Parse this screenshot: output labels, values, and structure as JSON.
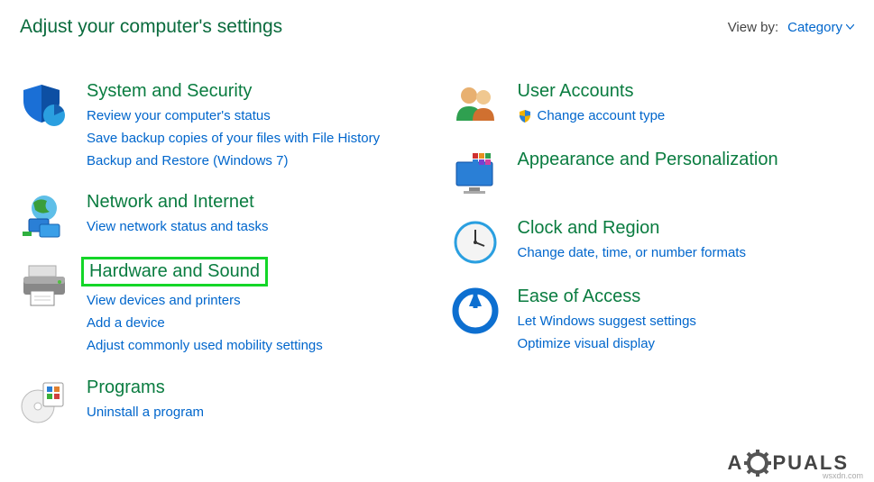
{
  "header": {
    "title": "Adjust your computer's settings",
    "view_by_label": "View by:",
    "view_by_value": "Category"
  },
  "left": [
    {
      "title": "System and Security",
      "links": [
        "Review your computer's status",
        "Save backup copies of your files with File History",
        "Backup and Restore (Windows 7)"
      ]
    },
    {
      "title": "Network and Internet",
      "links": [
        "View network status and tasks"
      ]
    },
    {
      "title": "Hardware and Sound",
      "highlighted": true,
      "links": [
        "View devices and printers",
        "Add a device",
        "Adjust commonly used mobility settings"
      ]
    },
    {
      "title": "Programs",
      "links": [
        "Uninstall a program"
      ]
    }
  ],
  "right": [
    {
      "title": "User Accounts",
      "links": [
        "Change account type"
      ],
      "shield_on_first": true
    },
    {
      "title": "Appearance and Personalization",
      "links": []
    },
    {
      "title": "Clock and Region",
      "links": [
        "Change date, time, or number formats"
      ]
    },
    {
      "title": "Ease of Access",
      "links": [
        "Let Windows suggest settings",
        "Optimize visual display"
      ]
    }
  ],
  "watermark": {
    "pre": "A",
    "post": "PUALS"
  },
  "attrib": "wsxdn.com"
}
